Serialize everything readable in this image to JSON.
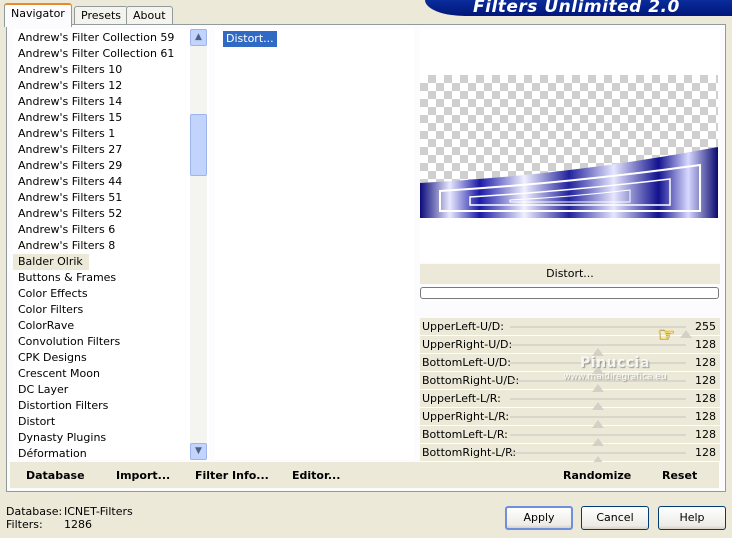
{
  "tabs": [
    {
      "label": "Navigator"
    },
    {
      "label": "Presets"
    },
    {
      "label": "About"
    }
  ],
  "banner_title": "Filters Unlimited 2.0",
  "filter_list": [
    "Andrew's Filter Collection 59",
    "Andrew's Filter Collection 61",
    "Andrew's Filters 10",
    "Andrew's Filters 12",
    "Andrew's Filters 14",
    "Andrew's Filters 15",
    "Andrew's Filters 1",
    "Andrew's Filters 27",
    "Andrew's Filters 29",
    "Andrew's Filters 44",
    "Andrew's Filters 51",
    "Andrew's Filters 52",
    "Andrew's Filters 6",
    "Andrew's Filters 8",
    "Balder Olrik",
    "Buttons & Frames",
    "Color Effects",
    "Color Filters",
    "ColorRave",
    "Convolution Filters",
    "CPK Designs",
    "Crescent Moon",
    "DC Layer",
    "Distortion Filters",
    "Distort",
    "Dynasty Plugins",
    "Déformation"
  ],
  "selected_filter": "Balder Olrik",
  "effect_item": "Distort...",
  "effect_label": "Distort...",
  "progress": 0,
  "sliders": [
    {
      "label": "UpperLeft-U/D:",
      "value": "255",
      "level": 255
    },
    {
      "label": "UpperRight-U/D:",
      "value": "128",
      "level": 128
    },
    {
      "label": "BottomLeft-U/D:",
      "value": "128",
      "level": 128
    },
    {
      "label": "BottomRight-U/D:",
      "value": "128",
      "level": 128
    },
    {
      "label": "UpperLeft-L/R:",
      "value": "128",
      "level": 128
    },
    {
      "label": "UpperRight-L/R:",
      "value": "128",
      "level": 128
    },
    {
      "label": "BottomLeft-L/R:",
      "value": "128",
      "level": 128
    },
    {
      "label": "BottomRight-L/R:",
      "value": "128",
      "level": 128
    }
  ],
  "watermark": {
    "line1": "Pinuccia",
    "line2": "www.maidiregrafica.eu"
  },
  "bottom_buttons": {
    "database": "Database",
    "import": "Import...",
    "filter_info": "Filter Info...",
    "editor": "Editor...",
    "randomize": "Randomize",
    "reset": "Reset"
  },
  "footer": {
    "database_label": "Database:",
    "database_value": "ICNET-Filters",
    "filters_label": "Filters:",
    "filters_value": "1286"
  },
  "dialog_buttons": {
    "apply": "Apply",
    "cancel": "Cancel",
    "help": "Help"
  },
  "colors": {
    "accent": "#316ac5",
    "banner": "#0a2c9a",
    "preview_shape": "#1a1a9e"
  }
}
